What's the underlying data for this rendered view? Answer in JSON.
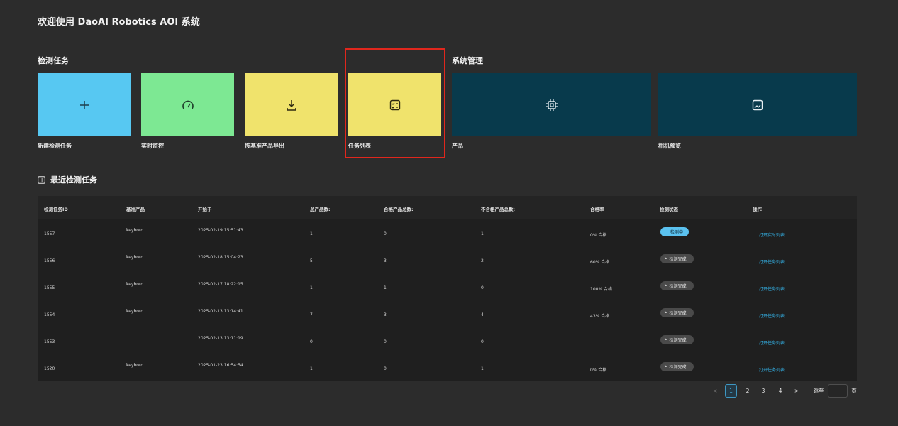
{
  "header": {
    "title": "欢迎使用 DaoAI Robotics AOI 系统"
  },
  "sections": {
    "inspection": "检测任务",
    "system": "系统管理",
    "recent": "最近检测任务"
  },
  "tiles": [
    {
      "label": "新建检测任务",
      "icon": "plus-icon",
      "color": "#57c8f2"
    },
    {
      "label": "实时监控",
      "icon": "gauge-icon",
      "color": "#7de893"
    },
    {
      "label": "按基准产品导出",
      "icon": "download-icon",
      "color": "#f0e36c"
    },
    {
      "label": "任务列表",
      "icon": "checklist-icon",
      "color": "#f0e36c"
    },
    {
      "label": "产品",
      "icon": "chip-icon",
      "color": "#083a4c"
    },
    {
      "label": "相机预览",
      "icon": "image-icon",
      "color": "#083a4c"
    }
  ],
  "table": {
    "headers": [
      "检测任务ID",
      "基准产品",
      "开始于",
      "总产品数:",
      "合格产品总数:",
      "不合格产品总数:",
      "合格率",
      "检测状态",
      "操作"
    ],
    "rows": [
      {
        "id": "1557",
        "product": "keybord",
        "start": "2025-02-19 15:51:43",
        "total": "1",
        "pass": "0",
        "fail": "1",
        "rate": "0% 合格",
        "status": "检测中",
        "status_type": "running",
        "action": "打开实时列表"
      },
      {
        "id": "1556",
        "product": "keybord",
        "start": "2025-02-18 15:04:23",
        "total": "5",
        "pass": "3",
        "fail": "2",
        "rate": "60% 合格",
        "status": "检测完成",
        "status_type": "done",
        "action": "打开任务列表"
      },
      {
        "id": "1555",
        "product": "keybord",
        "start": "2025-02-17 18:22:15",
        "total": "1",
        "pass": "1",
        "fail": "0",
        "rate": "100% 合格",
        "status": "检测完成",
        "status_type": "done",
        "action": "打开任务列表"
      },
      {
        "id": "1554",
        "product": "keybord",
        "start": "2025-02-13 13:14:41",
        "total": "7",
        "pass": "3",
        "fail": "4",
        "rate": "43% 合格",
        "status": "检测完成",
        "status_type": "done",
        "action": "打开任务列表"
      },
      {
        "id": "1553",
        "product": "",
        "start": "2025-02-13 13:11:19",
        "total": "0",
        "pass": "0",
        "fail": "0",
        "rate": "",
        "status": "检测完成",
        "status_type": "done",
        "action": "打开任务列表"
      },
      {
        "id": "1520",
        "product": "keybord",
        "start": "2025-01-23 16:54:54",
        "total": "1",
        "pass": "0",
        "fail": "1",
        "rate": "0% 合格",
        "status": "检测完成",
        "status_type": "done",
        "action": "打开任务列表"
      }
    ]
  },
  "pagination": {
    "prev": "<",
    "pages": [
      "1",
      "2",
      "3",
      "4"
    ],
    "current": "1",
    "next": ">",
    "jump_label": "跳至",
    "page_suffix": "页"
  },
  "colors": {
    "background": "#2c2c2c",
    "link": "#34b4ea",
    "highlight": "#e0271d",
    "running_badge": "#5bc2f0"
  }
}
